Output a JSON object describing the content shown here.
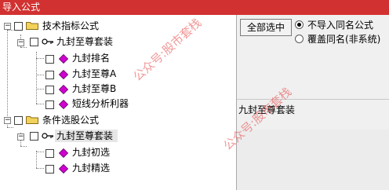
{
  "window": {
    "title": "导入公式"
  },
  "tree": {
    "groups": [
      {
        "label": "技术指标公式",
        "expander": "−",
        "packages": [
          {
            "label": "九封至尊套装",
            "expander": "−",
            "items": [
              {
                "label": "九封排名"
              },
              {
                "label": "九封至尊A"
              },
              {
                "label": "九封至尊B"
              },
              {
                "label": "短线分析利器"
              }
            ]
          }
        ]
      },
      {
        "label": "条件选股公式",
        "expander": "−",
        "packages": [
          {
            "label": "九封至尊套装",
            "expander": "−",
            "items": [
              {
                "label": "九封初选"
              },
              {
                "label": "九封精选"
              }
            ]
          }
        ]
      }
    ]
  },
  "options": {
    "select_all_label": "全部选中",
    "radio_no_import": "不导入同名公式",
    "radio_overwrite": "覆盖同名(非系统)",
    "selected_radio": "no_import"
  },
  "description": {
    "text": "九封至尊套装"
  },
  "watermark": {
    "text": "公众号:股市套栈"
  },
  "colors": {
    "titlebar": "#d23131",
    "diamond": "#d000d0",
    "folder": "#f2d25a"
  }
}
